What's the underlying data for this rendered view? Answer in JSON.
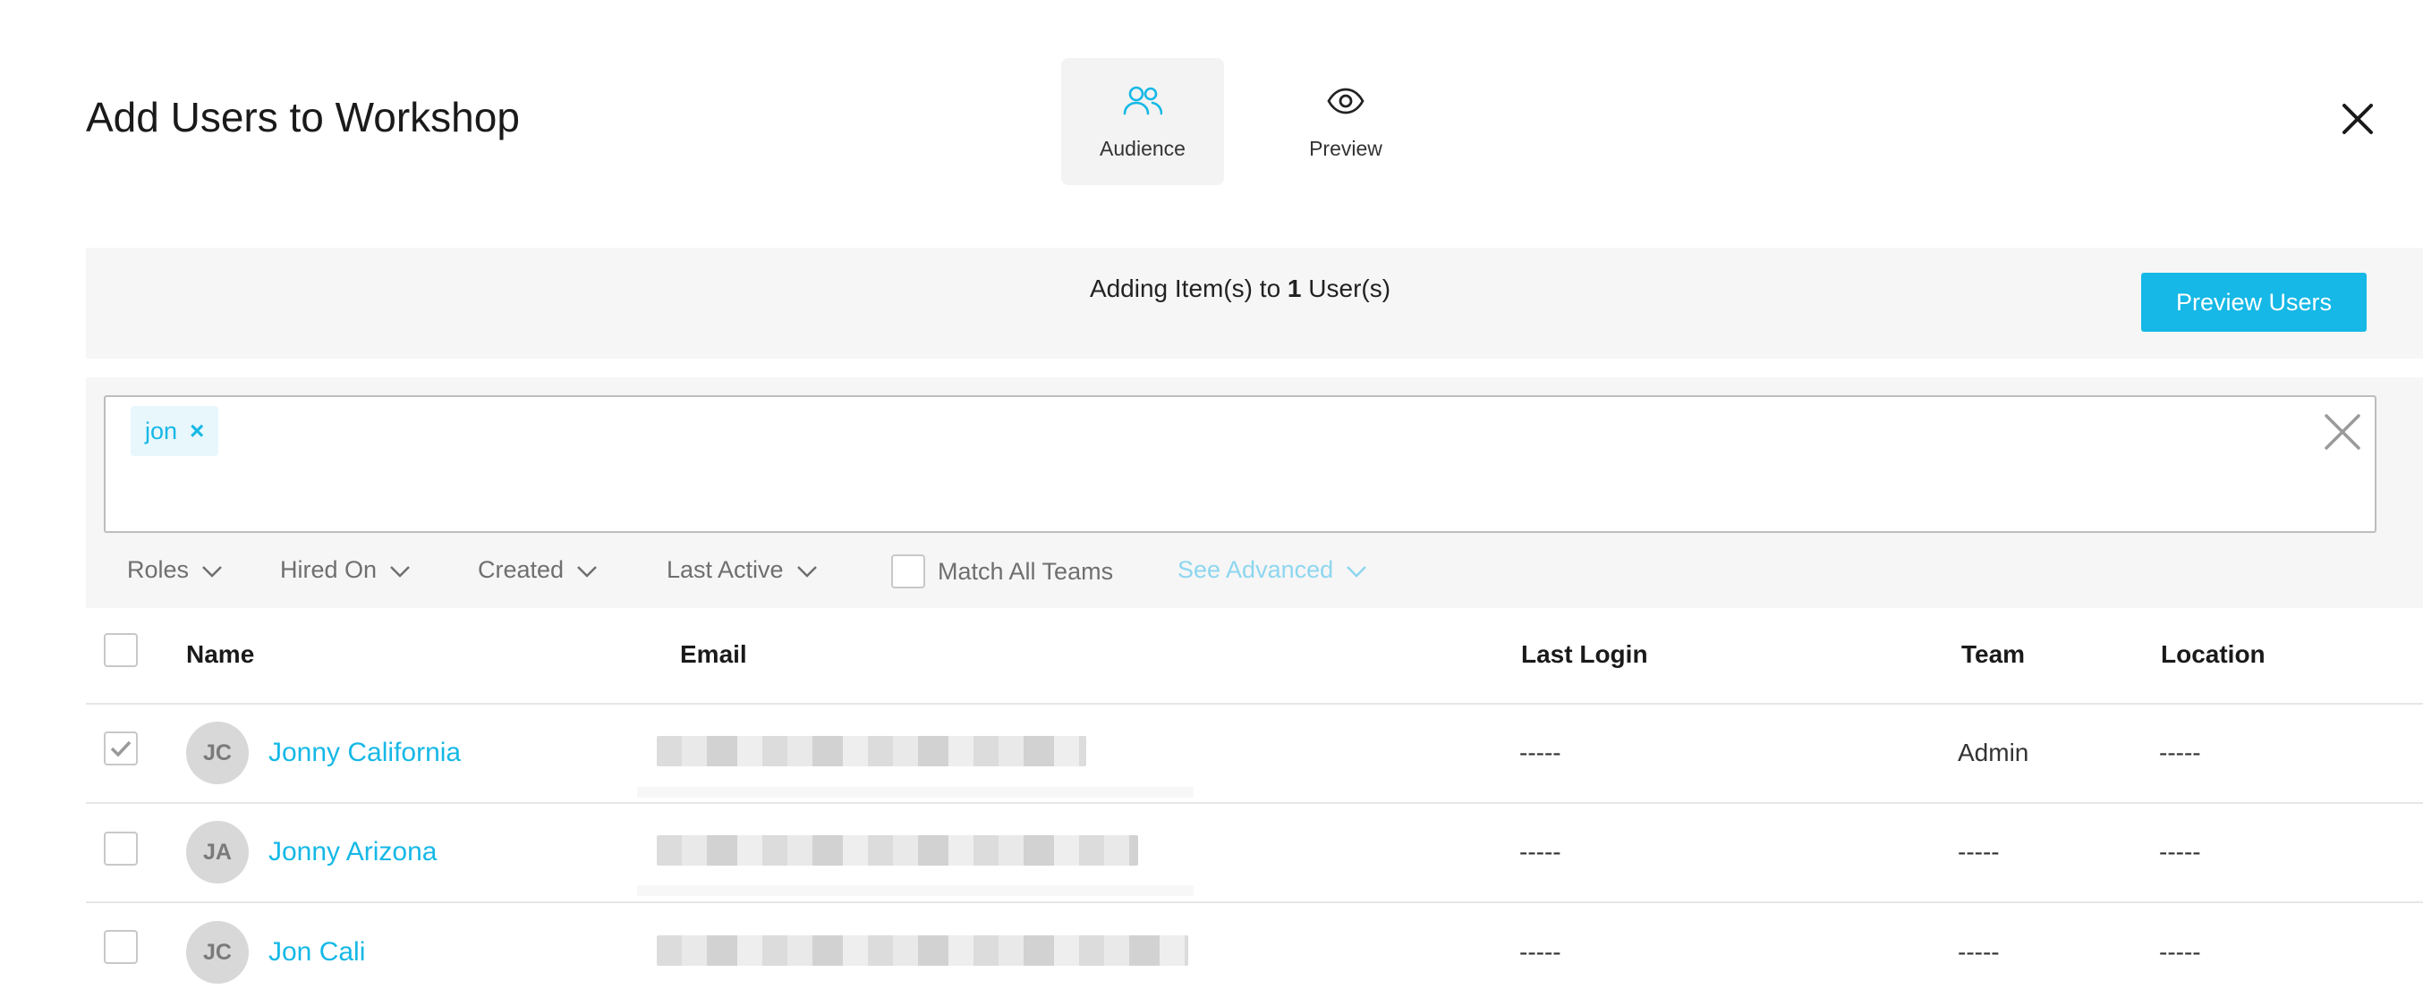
{
  "modal": {
    "title": "Add Users to Workshop",
    "tabs": [
      {
        "label": "Audience",
        "icon": "users-icon",
        "active": true
      },
      {
        "label": "Preview",
        "icon": "eye-icon",
        "active": false
      }
    ]
  },
  "banner": {
    "text_before": "Adding Item(s) to ",
    "count": "1",
    "text_after": " User(s)",
    "preview_button": "Preview Users"
  },
  "search": {
    "chips": [
      {
        "label": "jon"
      }
    ]
  },
  "filters": {
    "roles": "Roles",
    "hired_on": "Hired On",
    "created": "Created",
    "last_active": "Last Active",
    "match_all_teams": "Match All Teams",
    "see_advanced": "See Advanced"
  },
  "table": {
    "headers": {
      "name": "Name",
      "email": "Email",
      "last_login": "Last Login",
      "team": "Team",
      "location": "Location"
    },
    "rows": [
      {
        "initials": "JC",
        "name": "Jonny California",
        "checked": true,
        "last_login": "-----",
        "team": "Admin",
        "location": "-----"
      },
      {
        "initials": "JA",
        "name": "Jonny Arizona",
        "checked": false,
        "last_login": "-----",
        "team": "-----",
        "location": "-----"
      },
      {
        "initials": "JC",
        "name": "Jon Cali",
        "checked": false,
        "last_login": "-----",
        "team": "-----",
        "location": "-----"
      }
    ]
  },
  "colors": {
    "accent": "#15b8e6",
    "panel": "#f6f6f6",
    "muted_link": "#8dd6ef"
  }
}
